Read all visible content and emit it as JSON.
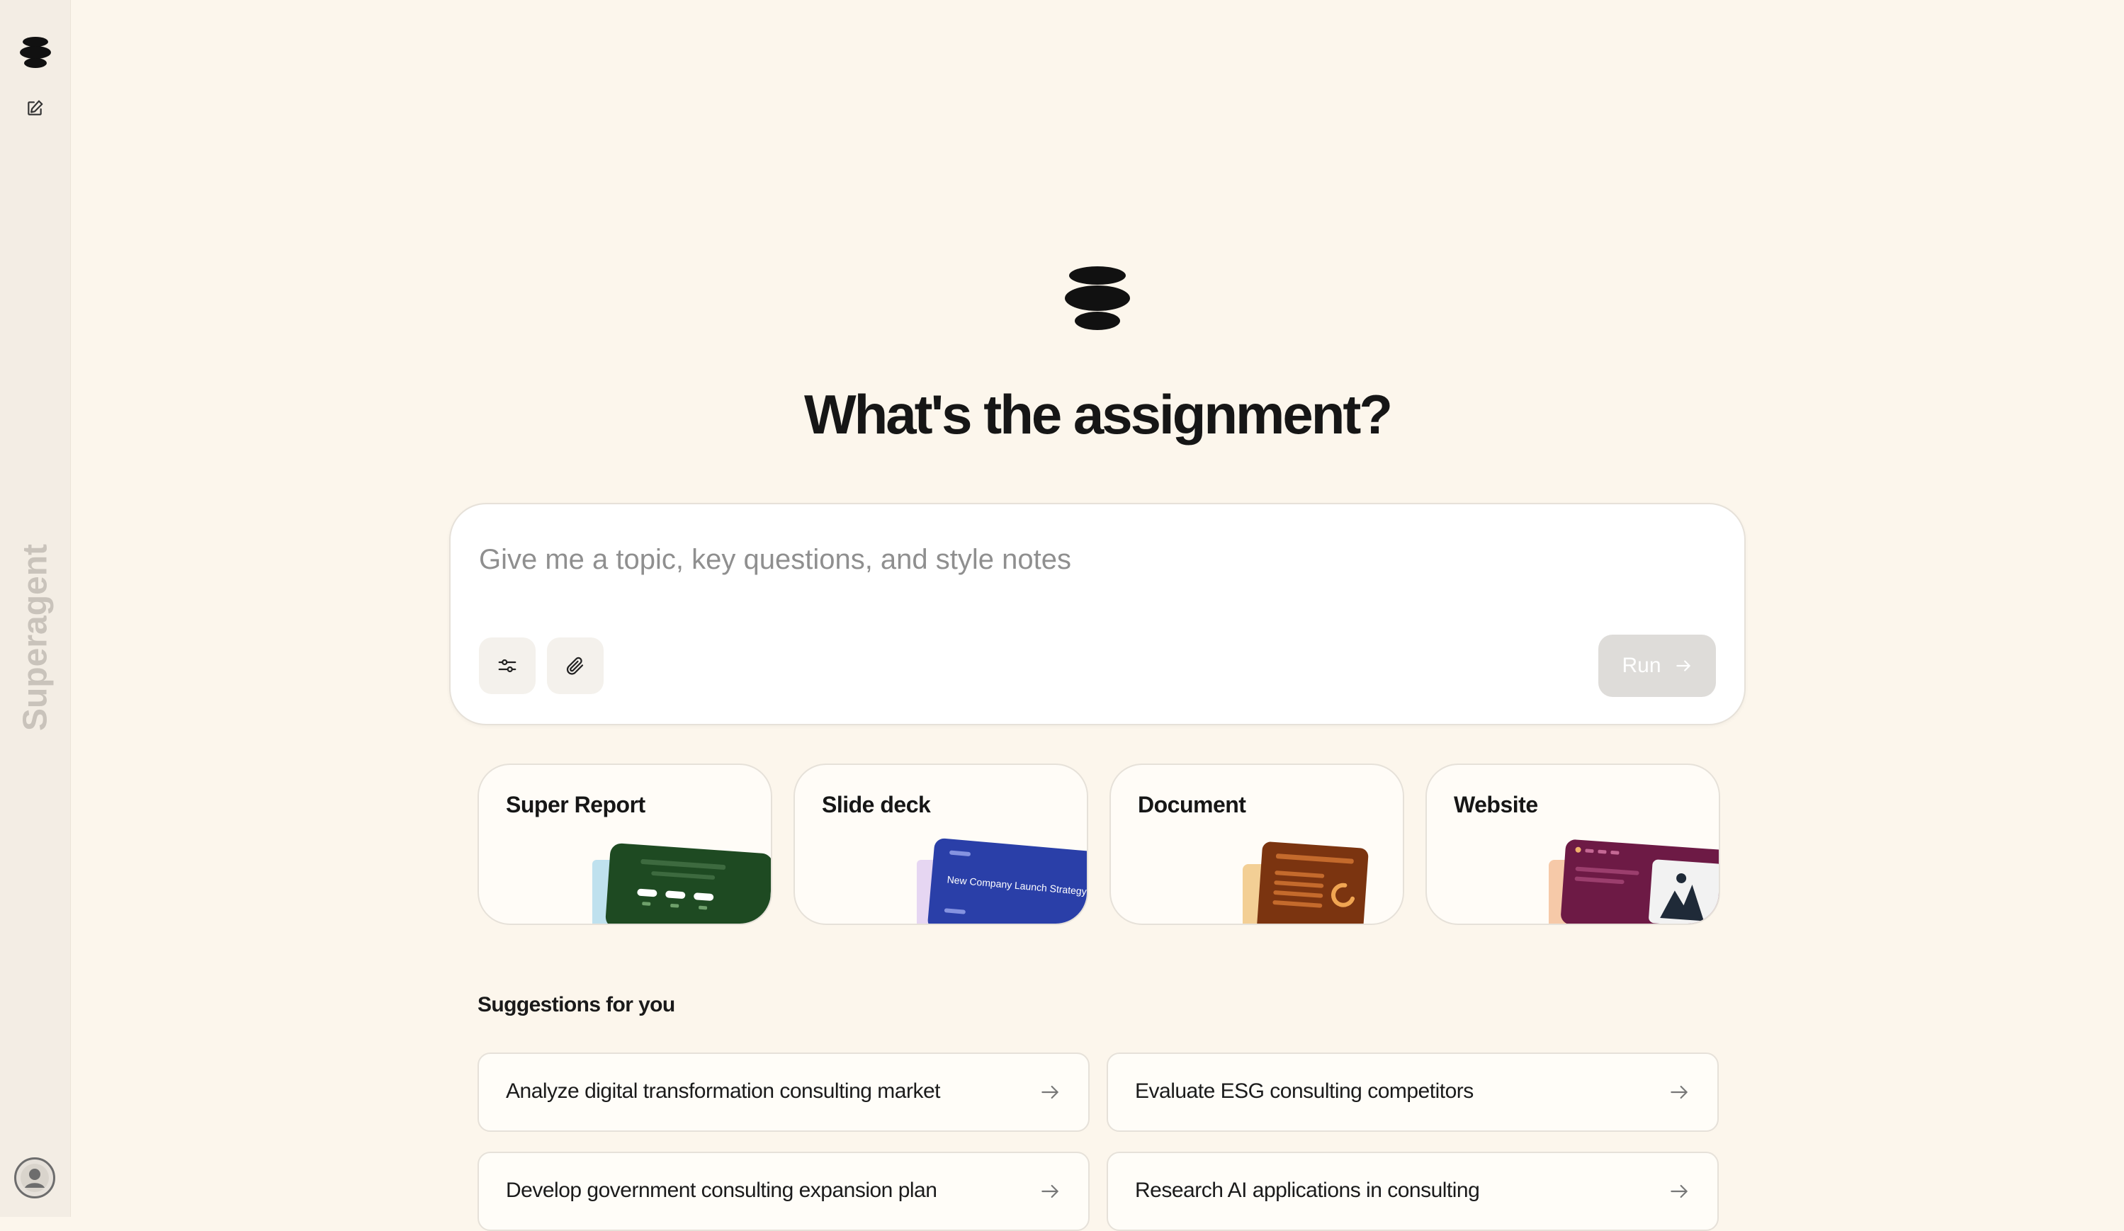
{
  "sidebar": {
    "brand": "Superagent",
    "icons": {
      "logo": "superagent-logo-icon",
      "new_chat": "edit-icon",
      "account": "user-avatar-icon"
    }
  },
  "main": {
    "headline": "What's the assignment?",
    "composer": {
      "placeholder": "Give me a topic, key questions, and style notes",
      "value": "",
      "run_label": "Run",
      "tools": [
        "sliders-icon",
        "paperclip-icon"
      ]
    },
    "types": [
      {
        "label": "Super Report",
        "thumb_color": "#1e4a22",
        "thumb_text": ""
      },
      {
        "label": "Slide deck",
        "thumb_color": "#2a3fa8",
        "thumb_text": "New Company Launch Strategy"
      },
      {
        "label": "Document",
        "thumb_color": "#7b3410",
        "thumb_text": ""
      },
      {
        "label": "Website",
        "thumb_color": "#6d1a45",
        "thumb_text": ""
      }
    ],
    "suggestions_title": "Suggestions for you",
    "suggestions": [
      {
        "label": "Analyze digital transformation consulting market"
      },
      {
        "label": "Evaluate ESG consulting competitors"
      },
      {
        "label": "Develop government consulting expansion plan"
      },
      {
        "label": "Research AI applications in consulting"
      }
    ]
  },
  "colors": {
    "background": "#fcf6ec",
    "sidebar": "#f3ede4",
    "card": "#fffcf7",
    "run_disabled": "#dedcd9"
  }
}
